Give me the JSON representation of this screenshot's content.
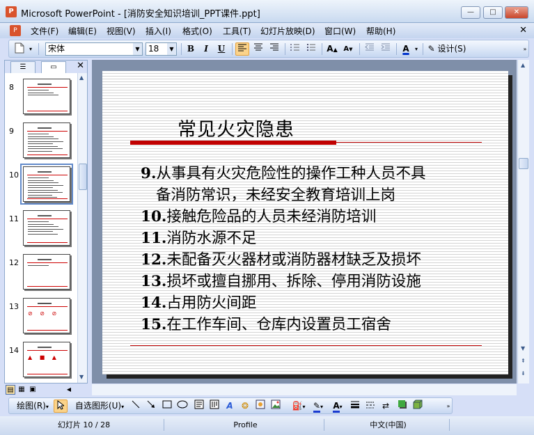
{
  "window": {
    "title": "Microsoft PowerPoint - [消防安全知识培训_PPT课件.ppt]",
    "minimize": "—",
    "maximize": "□",
    "close": "✕"
  },
  "menu": {
    "items": [
      "文件(F)",
      "编辑(E)",
      "视图(V)",
      "插入(I)",
      "格式(O)",
      "工具(T)",
      "幻灯片放映(D)",
      "窗口(W)",
      "帮助(H)"
    ],
    "close": "✕"
  },
  "toolbar": {
    "font_name": "宋体",
    "font_size": "18",
    "bold": "B",
    "italic": "I",
    "underline": "U",
    "increase_font": "A",
    "decrease_font": "A",
    "font_color": "A",
    "design_label": "设计(S)"
  },
  "panel": {
    "close": "✕",
    "thumbnails": [
      {
        "num": "8"
      },
      {
        "num": "9"
      },
      {
        "num": "10"
      },
      {
        "num": "11"
      },
      {
        "num": "12"
      },
      {
        "num": "13"
      },
      {
        "num": "14"
      }
    ]
  },
  "slide": {
    "title": "常见火灾隐患",
    "bullets": [
      {
        "num": "9.",
        "text": "从事具有火灾危险性的操作工种人员不具",
        "cont": "备消防常识，未经安全教育培训上岗"
      },
      {
        "num": "10.",
        "text": "接触危险品的人员未经消防培训"
      },
      {
        "num": "11.",
        "text": "消防水源不足"
      },
      {
        "num": "12.",
        "text": "未配备灭火器材或消防器材缺乏及损坏"
      },
      {
        "num": "13.",
        "text": "损坏或擅自挪用、拆除、停用消防设施"
      },
      {
        "num": "14.",
        "text": "占用防火间距"
      },
      {
        "num": "15.",
        "text": "在工作车间、仓库内设置员工宿舍"
      }
    ]
  },
  "drawing": {
    "draw_label": "绘图(R)",
    "autoshapes_label": "自选图形(U)"
  },
  "status": {
    "slide_info": "幻灯片 10 / 28",
    "design": "Profile",
    "language": "中文(中国)"
  },
  "colors": {
    "accent_red": "#c00000",
    "selection_orange": "#fbd38a",
    "chrome_blue": "#c6d7f1"
  }
}
